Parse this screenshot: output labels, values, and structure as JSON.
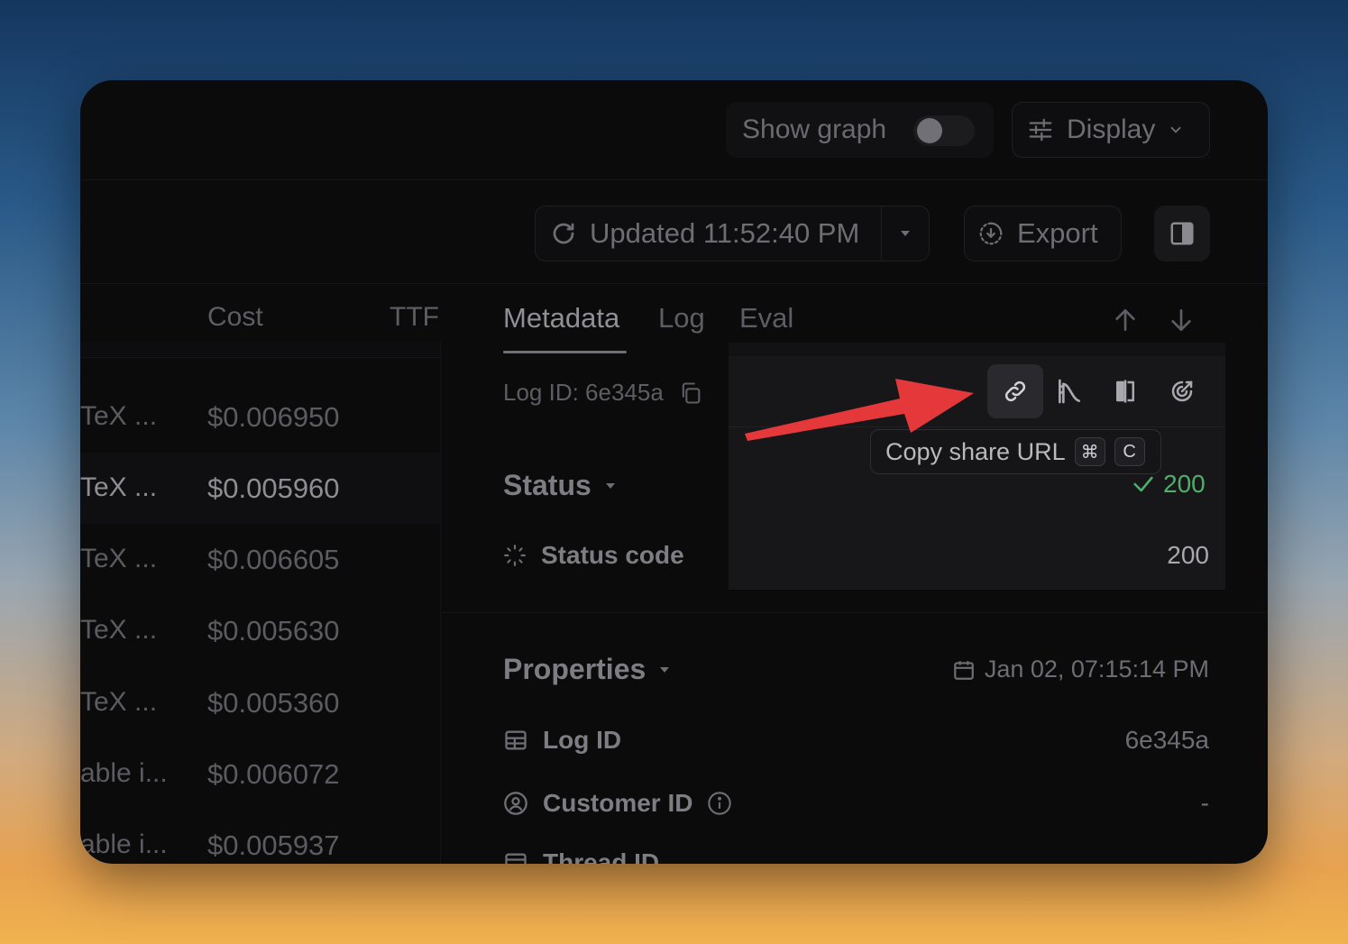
{
  "toolbar": {
    "show_graph_label": "Show graph",
    "show_graph_on": false,
    "display_label": "Display",
    "updated_label": "Updated 11:52:40 PM",
    "export_label": "Export"
  },
  "table": {
    "headers": [
      "Cost",
      "TTF"
    ],
    "rows": [
      {
        "name": "TeX ...",
        "cost": "$0.006950"
      },
      {
        "name": "TeX ...",
        "cost": "$0.005960",
        "selected": true
      },
      {
        "name": "TeX ...",
        "cost": "$0.006605"
      },
      {
        "name": "TeX ...",
        "cost": "$0.005630"
      },
      {
        "name": "TeX ...",
        "cost": "$0.005360"
      },
      {
        "name": "able i...",
        "cost": "$0.006072"
      },
      {
        "name": "able i...",
        "cost": "$0.005937"
      }
    ]
  },
  "detail": {
    "tabs": [
      "Metadata",
      "Log",
      "Eval"
    ],
    "active_tab": "Metadata",
    "log_id_label": "Log ID: 6e345a",
    "tooltip": {
      "text": "Copy share URL",
      "key1": "⌘",
      "key2": "C"
    },
    "status": {
      "title": "Status",
      "value": "200",
      "code_label": "Status code",
      "code_value": "200"
    },
    "properties": {
      "title": "Properties",
      "timestamp": "Jan 02, 07:15:14 PM",
      "items": [
        {
          "label": "Log ID",
          "value": "6e345a"
        },
        {
          "label": "Customer ID",
          "value": "-"
        },
        {
          "label": "Thread ID",
          "value": ""
        }
      ]
    }
  },
  "colors": {
    "success": "#4fae6a",
    "annotation_arrow": "#e5383b"
  }
}
